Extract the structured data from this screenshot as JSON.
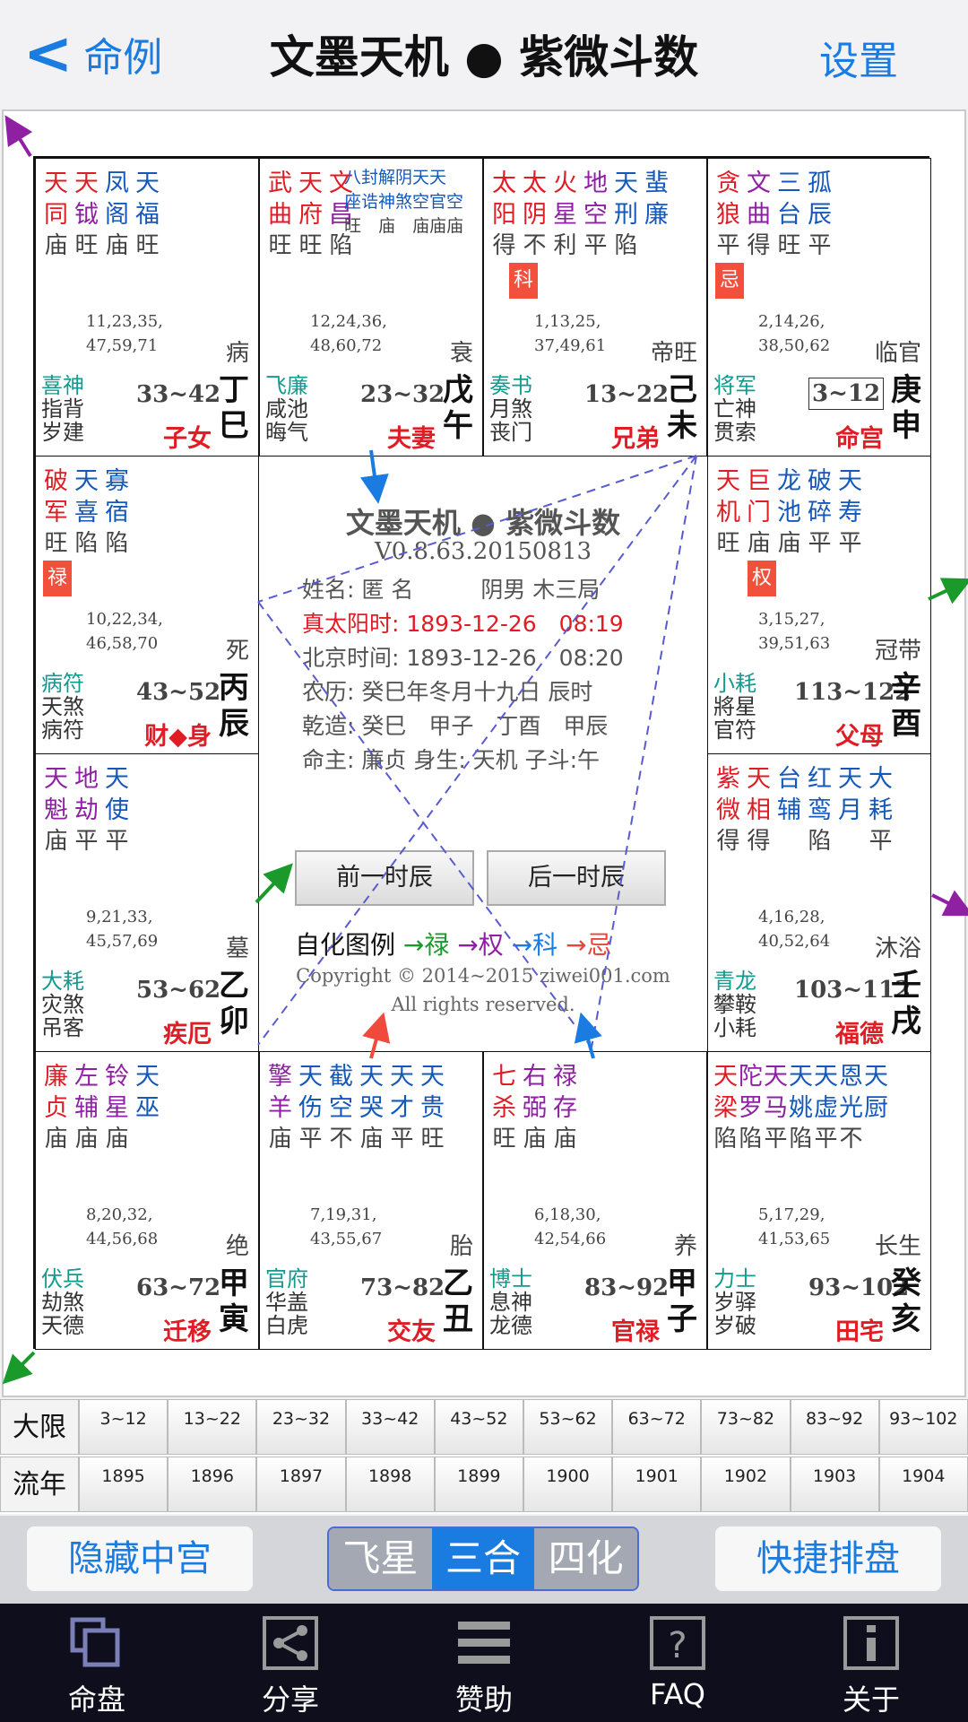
{
  "header": {
    "back_label": "命例",
    "title": "文墨天机 ● 紫微斗数",
    "settings_label": "设置"
  },
  "palaces": [
    {
      "id": "si",
      "rows": [
        [
          [
            "天",
            "c-red"
          ],
          [
            "天",
            "c-red"
          ],
          [
            "凤",
            "c-blue"
          ],
          [
            "天",
            "c-blue"
          ]
        ],
        [
          [
            "同",
            "c-red"
          ],
          [
            "钺",
            "c-purple"
          ],
          [
            "阁",
            "c-blue"
          ],
          [
            "福",
            "c-blue"
          ]
        ],
        [
          [
            "庙",
            "c-gray"
          ],
          [
            "旺",
            "c-gray"
          ],
          [
            "庙",
            "c-gray"
          ],
          [
            "旺",
            "c-gray"
          ]
        ]
      ],
      "nums1": "11,23,35,",
      "nums2": "47,59,71",
      "stage": "病",
      "gods": [
        "喜神",
        "指背",
        "岁建"
      ],
      "range": "33~42",
      "palace": "子女",
      "stem": "丁",
      "branch": "巳"
    },
    {
      "id": "wu",
      "rows": [
        [
          [
            "武",
            "c-red"
          ],
          [
            "天",
            "c-red"
          ],
          [
            "文",
            "c-red"
          ]
        ],
        [
          [
            "曲",
            "c-red"
          ],
          [
            "府",
            "c-red"
          ],
          [
            "昌",
            "c-purple"
          ]
        ],
        [
          [
            "旺",
            "c-gray"
          ],
          [
            "旺",
            "c-gray"
          ],
          [
            "陷",
            "c-gray"
          ]
        ]
      ],
      "extra": [
        "八封解阴天天",
        "座诰神煞空官空",
        "旺　庙　庙庙庙"
      ],
      "nums1": "12,24,36,",
      "nums2": "48,60,72",
      "stage": "衰",
      "gods": [
        "飞廉",
        "咸池",
        "晦气"
      ],
      "range": "23~32",
      "palace": "夫妻",
      "stem": "戊",
      "branch": "午"
    },
    {
      "id": "wei",
      "rows": [
        [
          [
            "太",
            "c-red"
          ],
          [
            "太",
            "c-red"
          ],
          [
            "火",
            "c-red"
          ],
          [
            "地",
            "c-purple"
          ],
          [
            "天",
            "c-blue"
          ],
          [
            "蜚",
            "c-blue"
          ]
        ],
        [
          [
            "阳",
            "c-red"
          ],
          [
            "阴",
            "c-red"
          ],
          [
            "星",
            "c-purple"
          ],
          [
            "空",
            "c-purple"
          ],
          [
            "刑",
            "c-blue"
          ],
          [
            "廉",
            "c-blue"
          ]
        ],
        [
          [
            "得",
            "c-gray"
          ],
          [
            "不",
            "c-gray"
          ],
          [
            "利",
            "c-gray"
          ],
          [
            "平",
            "c-gray"
          ],
          [
            "陷",
            "c-gray"
          ],
          [
            "",
            "c-gray"
          ]
        ]
      ],
      "badge": "科",
      "nums1": "1,13,25,",
      "nums2": "37,49,61",
      "stage": "帝旺",
      "gods": [
        "奏书",
        "月煞",
        "丧门"
      ],
      "range": "13~22",
      "palace": "兄弟",
      "stem": "己",
      "branch": "未"
    },
    {
      "id": "shen",
      "rows": [
        [
          [
            "贪",
            "c-red"
          ],
          [
            "文",
            "c-purple"
          ],
          [
            "三",
            "c-blue"
          ],
          [
            "孤",
            "c-blue"
          ]
        ],
        [
          [
            "狼",
            "c-red"
          ],
          [
            "曲",
            "c-purple"
          ],
          [
            "台",
            "c-blue"
          ],
          [
            "辰",
            "c-blue"
          ]
        ],
        [
          [
            "平",
            "c-gray"
          ],
          [
            "得",
            "c-gray"
          ],
          [
            "旺",
            "c-gray"
          ],
          [
            "平",
            "c-gray"
          ]
        ]
      ],
      "badge": "忌",
      "nums1": "2,14,26,",
      "nums2": "38,50,62",
      "stage": "临官",
      "gods": [
        "将军",
        "亡神",
        "贯索"
      ],
      "range": "3~12",
      "palace": "命宫",
      "stem": "庚",
      "branch": "申"
    },
    {
      "id": "chen",
      "rows": [
        [
          [
            "破",
            "c-red"
          ],
          [
            "天",
            "c-blue"
          ],
          [
            "寡",
            "c-blue"
          ]
        ],
        [
          [
            "军",
            "c-red"
          ],
          [
            "喜",
            "c-blue"
          ],
          [
            "宿",
            "c-blue"
          ]
        ],
        [
          [
            "旺",
            "c-gray"
          ],
          [
            "陷",
            "c-gray"
          ],
          [
            "陷",
            "c-gray"
          ]
        ]
      ],
      "badge": "禄",
      "nums1": "10,22,34,",
      "nums2": "46,58,70",
      "stage": "死",
      "gods": [
        "病符",
        "天煞",
        "病符"
      ],
      "range": "43~52",
      "palace": "财◆身",
      "stem": "丙",
      "branch": "辰"
    },
    {
      "id": "you",
      "rows": [
        [
          [
            "天",
            "c-red"
          ],
          [
            "巨",
            "c-red"
          ],
          [
            "龙",
            "c-blue"
          ],
          [
            "破",
            "c-blue"
          ],
          [
            "天",
            "c-blue"
          ]
        ],
        [
          [
            "机",
            "c-red"
          ],
          [
            "门",
            "c-red"
          ],
          [
            "池",
            "c-blue"
          ],
          [
            "碎",
            "c-blue"
          ],
          [
            "寿",
            "c-blue"
          ]
        ],
        [
          [
            "旺",
            "c-gray"
          ],
          [
            "庙",
            "c-gray"
          ],
          [
            "庙",
            "c-gray"
          ],
          [
            "平",
            "c-gray"
          ],
          [
            "平",
            "c-gray"
          ]
        ]
      ],
      "badge": "权",
      "nums1": "3,15,27,",
      "nums2": "39,51,63",
      "stage": "冠带",
      "gods": [
        "小耗",
        "將星",
        "官符"
      ],
      "range": "113~122",
      "palace": "父母",
      "stem": "辛",
      "branch": "酉"
    },
    {
      "id": "mao",
      "rows": [
        [
          [
            "天",
            "c-purple"
          ],
          [
            "地",
            "c-purple"
          ],
          [
            "天",
            "c-blue"
          ]
        ],
        [
          [
            "魁",
            "c-purple"
          ],
          [
            "劫",
            "c-purple"
          ],
          [
            "使",
            "c-blue"
          ]
        ],
        [
          [
            "庙",
            "c-gray"
          ],
          [
            "平",
            "c-gray"
          ],
          [
            "平",
            "c-gray"
          ]
        ]
      ],
      "nums1": "9,21,33,",
      "nums2": "45,57,69",
      "stage": "墓",
      "gods": [
        "大耗",
        "灾煞",
        "吊客"
      ],
      "range": "53~62",
      "palace": "疾厄",
      "stem": "乙",
      "branch": "卯"
    },
    {
      "id": "xu",
      "rows": [
        [
          [
            "紫",
            "c-red"
          ],
          [
            "天",
            "c-red"
          ],
          [
            "台",
            "c-blue"
          ],
          [
            "红",
            "c-blue"
          ],
          [
            "天",
            "c-blue"
          ],
          [
            "大",
            "c-blue"
          ]
        ],
        [
          [
            "微",
            "c-red"
          ],
          [
            "相",
            "c-red"
          ],
          [
            "辅",
            "c-blue"
          ],
          [
            "鸾",
            "c-blue"
          ],
          [
            "月",
            "c-blue"
          ],
          [
            "耗",
            "c-blue"
          ]
        ],
        [
          [
            "得",
            "c-gray"
          ],
          [
            "得",
            "c-gray"
          ],
          [
            "",
            "c-gray"
          ],
          [
            "陷",
            "c-gray"
          ],
          [
            "",
            "c-gray"
          ],
          [
            "平",
            "c-gray"
          ]
        ]
      ],
      "nums1": "4,16,28,",
      "nums2": "40,52,64",
      "stage": "沐浴",
      "gods": [
        "青龙",
        "攀鞍",
        "小耗"
      ],
      "range": "103~112",
      "palace": "福德",
      "stem": "壬",
      "branch": "戌"
    },
    {
      "id": "yin",
      "rows": [
        [
          [
            "廉",
            "c-red"
          ],
          [
            "左",
            "c-purple"
          ],
          [
            "铃",
            "c-purple"
          ],
          [
            "天",
            "c-blue"
          ]
        ],
        [
          [
            "贞",
            "c-red"
          ],
          [
            "辅",
            "c-purple"
          ],
          [
            "星",
            "c-purple"
          ],
          [
            "巫",
            "c-blue"
          ]
        ],
        [
          [
            "庙",
            "c-gray"
          ],
          [
            "庙",
            "c-gray"
          ],
          [
            "庙",
            "c-gray"
          ],
          [
            "",
            "c-gray"
          ]
        ]
      ],
      "nums1": "8,20,32,",
      "nums2": "44,56,68",
      "stage": "绝",
      "gods": [
        "伏兵",
        "劫煞",
        "天德"
      ],
      "range": "63~72",
      "palace": "迁移",
      "stem": "甲",
      "branch": "寅"
    },
    {
      "id": "chou",
      "rows": [
        [
          [
            "擎",
            "c-purple"
          ],
          [
            "天",
            "c-blue"
          ],
          [
            "截",
            "c-blue"
          ],
          [
            "天",
            "c-blue"
          ],
          [
            "天",
            "c-blue"
          ],
          [
            "天",
            "c-blue"
          ]
        ],
        [
          [
            "羊",
            "c-purple"
          ],
          [
            "伤",
            "c-blue"
          ],
          [
            "空",
            "c-blue"
          ],
          [
            "哭",
            "c-blue"
          ],
          [
            "才",
            "c-blue"
          ],
          [
            "贵",
            "c-blue"
          ]
        ],
        [
          [
            "庙",
            "c-gray"
          ],
          [
            "平",
            "c-gray"
          ],
          [
            "不",
            "c-gray"
          ],
          [
            "庙",
            "c-gray"
          ],
          [
            "平",
            "c-gray"
          ],
          [
            "旺",
            "c-gray"
          ]
        ]
      ],
      "nums1": "7,19,31,",
      "nums2": "43,55,67",
      "stage": "胎",
      "gods": [
        "官府",
        "华盖",
        "白虎"
      ],
      "range": "73~82",
      "palace": "交友",
      "stem": "乙",
      "branch": "丑"
    },
    {
      "id": "zi",
      "rows": [
        [
          [
            "七",
            "c-red"
          ],
          [
            "右",
            "c-purple"
          ],
          [
            "禄",
            "c-purple"
          ]
        ],
        [
          [
            "杀",
            "c-red"
          ],
          [
            "弼",
            "c-purple"
          ],
          [
            "存",
            "c-purple"
          ]
        ],
        [
          [
            "旺",
            "c-gray"
          ],
          [
            "庙",
            "c-gray"
          ],
          [
            "庙",
            "c-gray"
          ]
        ]
      ],
      "nums1": "6,18,30,",
      "nums2": "42,54,66",
      "stage": "养",
      "gods": [
        "博士",
        "息神",
        "龙德"
      ],
      "range": "83~92",
      "palace": "官禄",
      "stem": "甲",
      "branch": "子"
    },
    {
      "id": "hai",
      "rows": [
        [
          [
            "天",
            "c-red"
          ],
          [
            "陀",
            "c-purple"
          ],
          [
            "天",
            "c-purple"
          ],
          [
            "天",
            "c-blue"
          ],
          [
            "天",
            "c-blue"
          ],
          [
            "恩",
            "c-blue"
          ],
          [
            "天",
            "c-blue"
          ]
        ],
        [
          [
            "梁",
            "c-red"
          ],
          [
            "罗",
            "c-purple"
          ],
          [
            "马",
            "c-purple"
          ],
          [
            "姚",
            "c-blue"
          ],
          [
            "虚",
            "c-blue"
          ],
          [
            "光",
            "c-blue"
          ],
          [
            "厨",
            "c-blue"
          ]
        ],
        [
          [
            "陷",
            "c-gray"
          ],
          [
            "陷",
            "c-gray"
          ],
          [
            "平",
            "c-gray"
          ],
          [
            "陷",
            "c-gray"
          ],
          [
            "平",
            "c-gray"
          ],
          [
            "不",
            "c-gray"
          ],
          [
            "",
            "c-gray"
          ]
        ]
      ],
      "nums1": "5,17,29,",
      "nums2": "41,53,65",
      "stage": "长生",
      "gods": [
        "力士",
        "岁驿",
        "岁破"
      ],
      "range": "93~102",
      "palace": "田宅",
      "stem": "癸",
      "branch": "亥"
    }
  ],
  "center": {
    "title": "文墨天机 ● 紫微斗数",
    "version": "V0.8.63.20150813",
    "name_line": "姓名: 匿 名　　　阴男 木三局",
    "solar_line": "真太阳时: 1893-12-26　08:19",
    "beijing_line": "北京时间: 1893-12-26　08:20",
    "lunar_line": "农历: 癸巳年冬月十九日 辰时",
    "bazi_line": "乾造: 癸巳　甲子　丁酉　甲辰",
    "master_line": "命主: 廉贞 身生: 天机 子斗:午",
    "prev_hour": "前一时辰",
    "next_hour": "后一时辰",
    "legend_label": "自化图例",
    "legend_lu": "禄",
    "legend_quan": "权",
    "legend_ke": "科",
    "legend_ji": "忌",
    "copyright1": "Copyright © 2014~2015 ziwei001.com",
    "copyright2": "All rights reserved."
  },
  "table": {
    "daxian_label": "大限",
    "liunian_label": "流年",
    "daxian": [
      "3~12",
      "13~22",
      "23~32",
      "33~42",
      "43~52",
      "53~62",
      "63~72",
      "73~82",
      "83~92",
      "93~102"
    ],
    "liunian": [
      "1895",
      "1896",
      "1897",
      "1898",
      "1899",
      "1900",
      "1901",
      "1902",
      "1903",
      "1904"
    ]
  },
  "actions": {
    "hide_center": "隐藏中宫",
    "seg": [
      "飞星",
      "三合",
      "四化"
    ],
    "seg_active": 1,
    "quick": "快捷排盘"
  },
  "nav": [
    {
      "label": "命盘",
      "icon": "chart-icon"
    },
    {
      "label": "分享",
      "icon": "share-icon"
    },
    {
      "label": "赞助",
      "icon": "menu-icon"
    },
    {
      "label": "FAQ",
      "icon": "question-icon"
    },
    {
      "label": "关于",
      "icon": "info-icon"
    }
  ],
  "colors": {
    "accent": "#1a7ce0",
    "red": "#e01c24",
    "purple": "#8f20a4",
    "blue": "#1458ba",
    "green": "#139a8e",
    "badge": "#f0503c",
    "nav_bg": "#0e0e1c"
  }
}
